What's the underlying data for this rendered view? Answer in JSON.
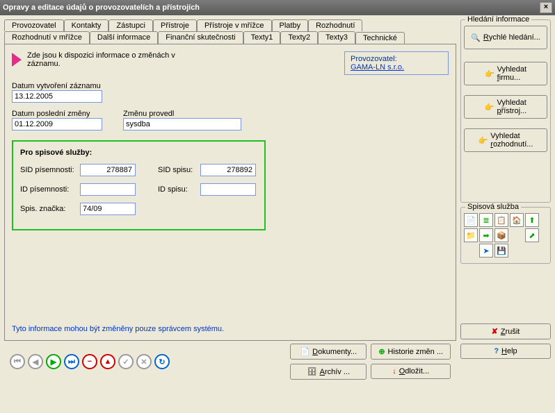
{
  "title": "Opravy a editace údajů o provozovatelích a přístrojích",
  "tabs_row1": [
    "Provozovatel",
    "Kontakty",
    "Zástupci",
    "Přístroje",
    "Přístroje v mřížce",
    "Platby",
    "Rozhodnutí"
  ],
  "tabs_row2": [
    "Rozhodnutí v mřížce",
    "Další informace",
    "Finanční skutečnosti",
    "Texty1",
    "Texty2",
    "Texty3",
    "Technické"
  ],
  "active_tab": "Technické",
  "info_text": "Zde jsou k dispozici informace o změnách v záznamu.",
  "prov_label": "Provozovatel:",
  "prov_value": "GAMA-LN s.r.o.",
  "lbl_created": "Datum vytvoření záznamu",
  "val_created": "13.12.2005",
  "lbl_modified": "Datum poslední změny",
  "val_modified": "01.12.2009",
  "lbl_changed_by": "Změnu provedl",
  "val_changed_by": "sysdba",
  "box_title": "Pro spisové služby:",
  "lbl_sid_pis": "SID písemnosti:",
  "val_sid_pis": "278887",
  "lbl_sid_spis": "SID spisu:",
  "val_sid_spis": "278892",
  "lbl_id_pis": "ID písemnosti:",
  "val_id_pis": "",
  "lbl_id_spis": "ID spisu:",
  "val_id_spis": "",
  "lbl_spis_zn": "Spis. značka:",
  "val_spis_zn": "74/09",
  "footnote": "Tyto informace mohou být změněny pouze správcem systému.",
  "search_group": "Hledání informace",
  "btn_quick": "Rychlé hledání...",
  "btn_firm1": "Vyhledat",
  "btn_firm2": "firmu...",
  "btn_dev1": "Vyhledat",
  "btn_dev2": "přístroj...",
  "btn_dec1": "Vyhledat",
  "btn_dec2": "rozhodnutí...",
  "spis_group": "Spisová služba",
  "btn_docs": "Dokumenty...",
  "btn_hist": "Historie změn ...",
  "btn_arch": "Archív ...",
  "btn_defer": "Odložit...",
  "btn_cancel": "Zrušit",
  "btn_help": "Help"
}
